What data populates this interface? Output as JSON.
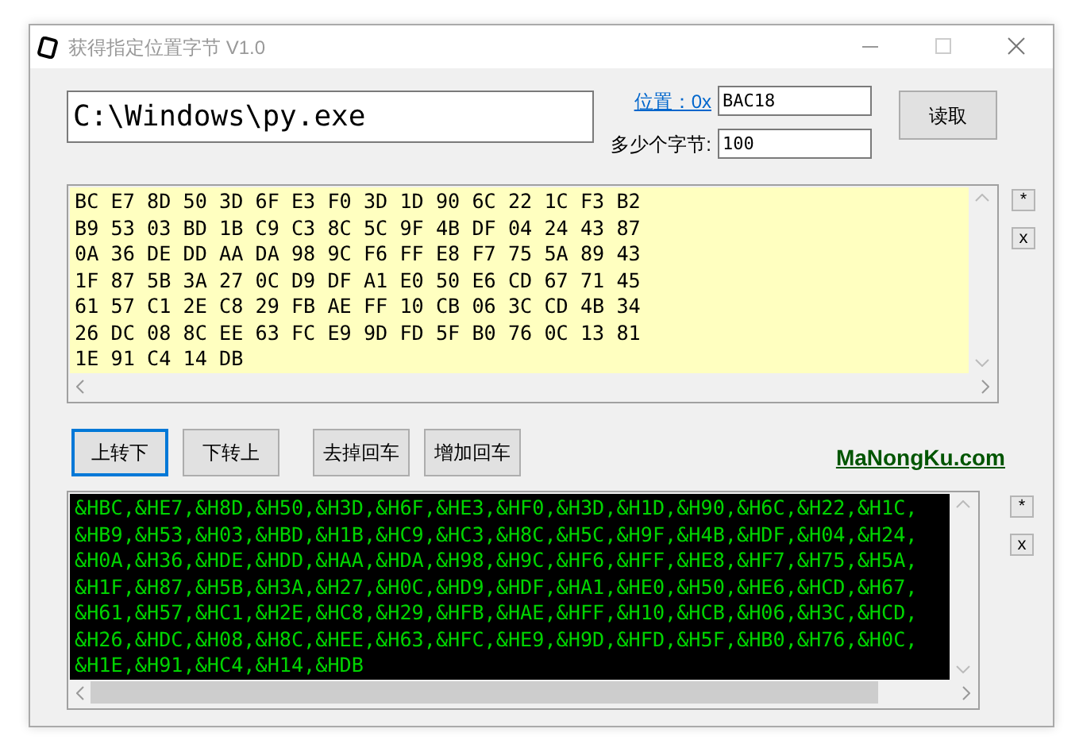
{
  "window": {
    "title": "获得指定位置字节 V1.0"
  },
  "file_path": {
    "value": "C:\\Windows\\py.exe"
  },
  "position": {
    "label": "位置：0x",
    "value": "BAC18"
  },
  "byte_count": {
    "label": "多少个字节:",
    "value": "100"
  },
  "read_button": "读取",
  "hex_view": {
    "lines": [
      "BC E7 8D 50 3D 6F E3 F0 3D 1D 90 6C 22 1C F3 B2",
      "B9 53 03 BD 1B C9 C3 8C 5C 9F 4B DF 04 24 43 87",
      "0A 36 DE DD AA DA 98 9C F6 FF E8 F7 75 5A 89 43",
      "1F 87 5B 3A 27 0C D9 DF A1 E0 50 E6 CD 67 71 45",
      "61 57 C1 2E C8 29 FB AE FF 10 CB 06 3C CD 4B 34",
      "26 DC 08 8C EE 63 FC E9 9D FD 5F B0 76 0C 13 81",
      "1E 91 C4 14 DB"
    ]
  },
  "hex_side_buttons": [
    "*",
    "x"
  ],
  "actions": [
    {
      "label": "上转下",
      "selected": true
    },
    {
      "label": "下转上",
      "selected": false
    },
    {
      "label": "去掉回车",
      "selected": false
    },
    {
      "label": "增加回车",
      "selected": false
    }
  ],
  "site_link": "MaNongKu.com",
  "output_view": {
    "lines": [
      "&HBC,&HE7,&H8D,&H50,&H3D,&H6F,&HE3,&HF0,&H3D,&H1D,&H90,&H6C,&H22,&H1C,",
      "&HB9,&H53,&H03,&HBD,&H1B,&HC9,&HC3,&H8C,&H5C,&H9F,&H4B,&HDF,&H04,&H24,",
      "&H0A,&H36,&HDE,&HDD,&HAA,&HDA,&H98,&H9C,&HF6,&HFF,&HE8,&HF7,&H75,&H5A,",
      "&H1F,&H87,&H5B,&H3A,&H27,&H0C,&HD9,&HDF,&HA1,&HE0,&H50,&HE6,&HCD,&H67,",
      "&H61,&H57,&HC1,&H2E,&HC8,&H29,&HFB,&HAE,&HFF,&H10,&HCB,&H06,&H3C,&HCD,",
      "&H26,&HDC,&H08,&H8C,&HEE,&H63,&HFC,&HE9,&H9D,&HFD,&H5F,&HB0,&H76,&H0C,",
      "&H1E,&H91,&HC4,&H14,&HDB"
    ]
  },
  "output_side_buttons": [
    "*",
    "x"
  ]
}
